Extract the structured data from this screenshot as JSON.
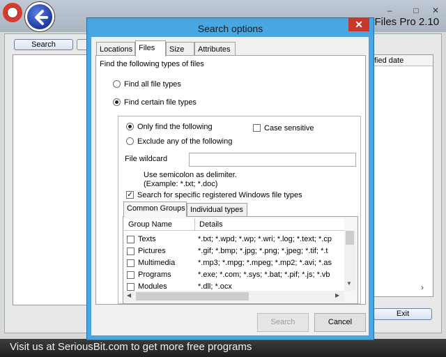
{
  "app": {
    "title": "yFiles Pro 2.10",
    "minimize_glyph": "–",
    "maximize_glyph": "□",
    "close_glyph": "✕",
    "search_button": "Search",
    "modified_header": "fied date",
    "exit_button": "Exit",
    "scroll_right_glyph": "›",
    "footer": "Visit us at SeriousBit.com to get more free programs"
  },
  "dialog": {
    "title": "Search options",
    "close_glyph": "✕",
    "tabs": [
      "Locations",
      "Files",
      "Size",
      "Attributes"
    ],
    "active_tab": "Files",
    "heading": "Find the following types of files",
    "radio_all": "Find all file types",
    "radio_certain": "Find certain file types",
    "selected_mode": "Find certain file types",
    "only_find": "Only find the following",
    "exclude_any": "Exclude any of the following",
    "case_sensitive": "Case sensitive",
    "case_sensitive_checked": false,
    "wildcard_label": "File wildcard",
    "wildcard_value": "",
    "hint_line1": "Use semicolon as delimiter.",
    "hint_line2": "(Example: *.txt; *.doc)",
    "registered_types": "Search for specific registered Windows file types",
    "registered_types_checked": true,
    "check_mark": "✓",
    "subtabs": [
      "Common Groups",
      "Individual types"
    ],
    "grid": {
      "headers": [
        "Group Name",
        "Details"
      ],
      "rows": [
        {
          "name": "Texts",
          "details": "*.txt; *.wpd; *.wp; *.wri; *.log; *.text; *.cp"
        },
        {
          "name": "Pictures",
          "details": "*.gif; *.bmp; *.jpg; *.png; *.jpeg; *.tif; *.t"
        },
        {
          "name": "Multimedia",
          "details": "*.mp3; *.mpg; *.mpeg; *.mp2; *.avi; *.as"
        },
        {
          "name": "Programs",
          "details": "*.exe; *.com; *.sys; *.bat; *.pif; *.js; *.vb"
        },
        {
          "name": "Modules",
          "details": "*.dll; *.ocx"
        }
      ]
    },
    "scroll_down_glyph": "▼",
    "scroll_left_glyph": "◀",
    "scroll_right_glyph": "▶",
    "search_button": "Search",
    "cancel_button": "Cancel"
  }
}
